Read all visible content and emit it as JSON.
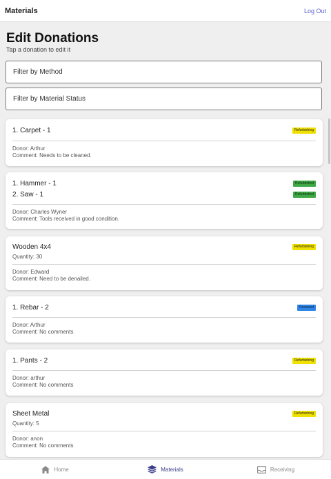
{
  "header": {
    "title": "Materials",
    "logout_label": "Log Out"
  },
  "page": {
    "title": "Edit Donations",
    "subtitle": "Tap a donation to edit it"
  },
  "filters": {
    "method_label": "Filter by Method",
    "status_label": "Filter by Material Status"
  },
  "donations": [
    {
      "items": [
        {
          "label": "1. Carpet - 1",
          "status": "Refurbishing"
        }
      ],
      "donor": "Donor: Arthur",
      "comment": "Comment: Needs to be cleaned."
    },
    {
      "items": [
        {
          "label": "1. Hammer - 1",
          "status": "Refurbished"
        },
        {
          "label": "2. Saw - 1",
          "status": "Refurbished"
        }
      ],
      "donor": "Donor: Charles Wyner",
      "comment": "Comment: Tools received in good condition."
    },
    {
      "items": [
        {
          "label": "Wooden 4x4",
          "status": "Refurbishing"
        }
      ],
      "quantity": "Quantity: 30",
      "donor": "Donor: Edward",
      "comment": "Comment: Need to be denailed."
    },
    {
      "items": [
        {
          "label": "1. Rebar - 2",
          "status": "Received"
        }
      ],
      "donor": "Donor: Arthur",
      "comment": "Comment: No comments"
    },
    {
      "items": [
        {
          "label": "1. Pants - 2",
          "status": "Refurbishing"
        }
      ],
      "donor": "Donor: arthur",
      "comment": "Comment: No comments"
    },
    {
      "items": [
        {
          "label": "Sheet Metal",
          "status": "Refurbishing"
        }
      ],
      "quantity": "Quantity: 5",
      "donor": "Donor: anon",
      "comment": "Comment: No comments"
    }
  ],
  "status_colors": {
    "Refurbishing": "#f0e000",
    "Refurbished": "#3ea845",
    "Received": "#2f86e8"
  },
  "nav": {
    "home_label": "Home",
    "home_icon": "home-icon",
    "materials_label": "Materials",
    "materials_icon": "layers-icon",
    "receiving_label": "Receiving",
    "receiving_icon": "inbox-icon",
    "active": "Materials"
  }
}
